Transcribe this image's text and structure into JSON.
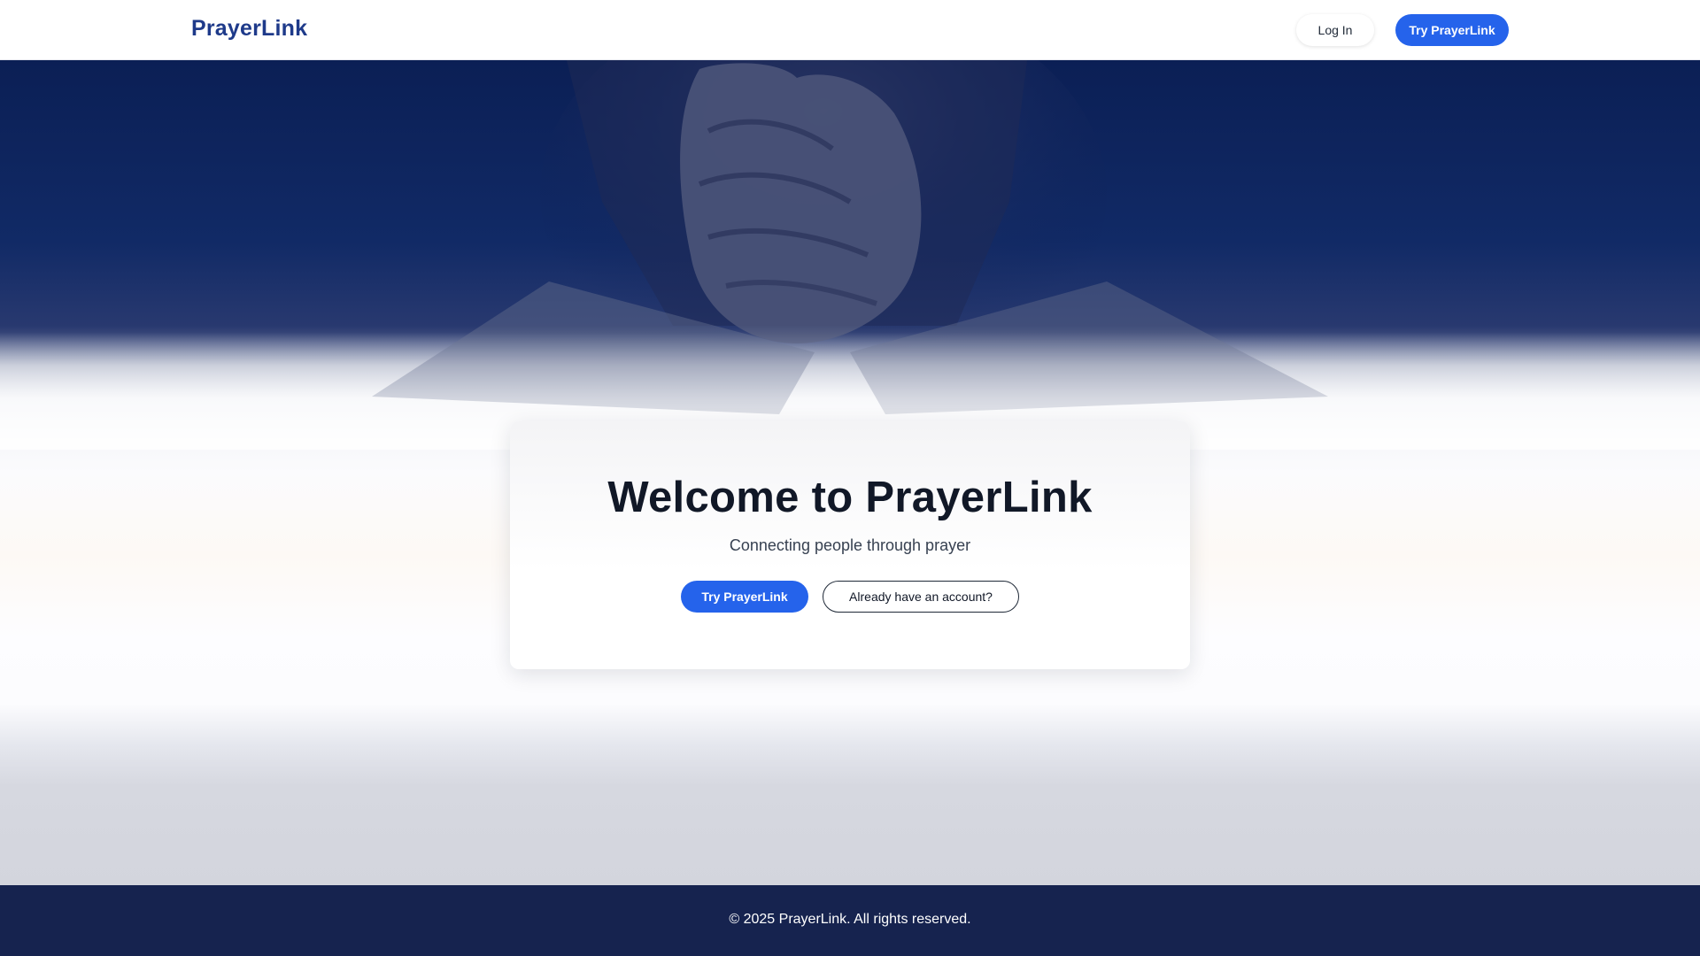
{
  "header": {
    "brand": "PrayerLink",
    "login_label": "Log In",
    "try_label": "Try PrayerLink"
  },
  "hero": {
    "image": "praying-hands-over-bible",
    "card": {
      "title": "Welcome to PrayerLink",
      "subtitle": "Connecting people through prayer",
      "primary_label": "Try PrayerLink",
      "secondary_label": "Already have an account?"
    }
  },
  "footer": {
    "text": "© 2025 PrayerLink. All rights reserved."
  },
  "colors": {
    "brand": "#1e3a8a",
    "accent": "#2563eb",
    "hero_dark": "#0b1f55",
    "footer_bg": "#16234f"
  }
}
